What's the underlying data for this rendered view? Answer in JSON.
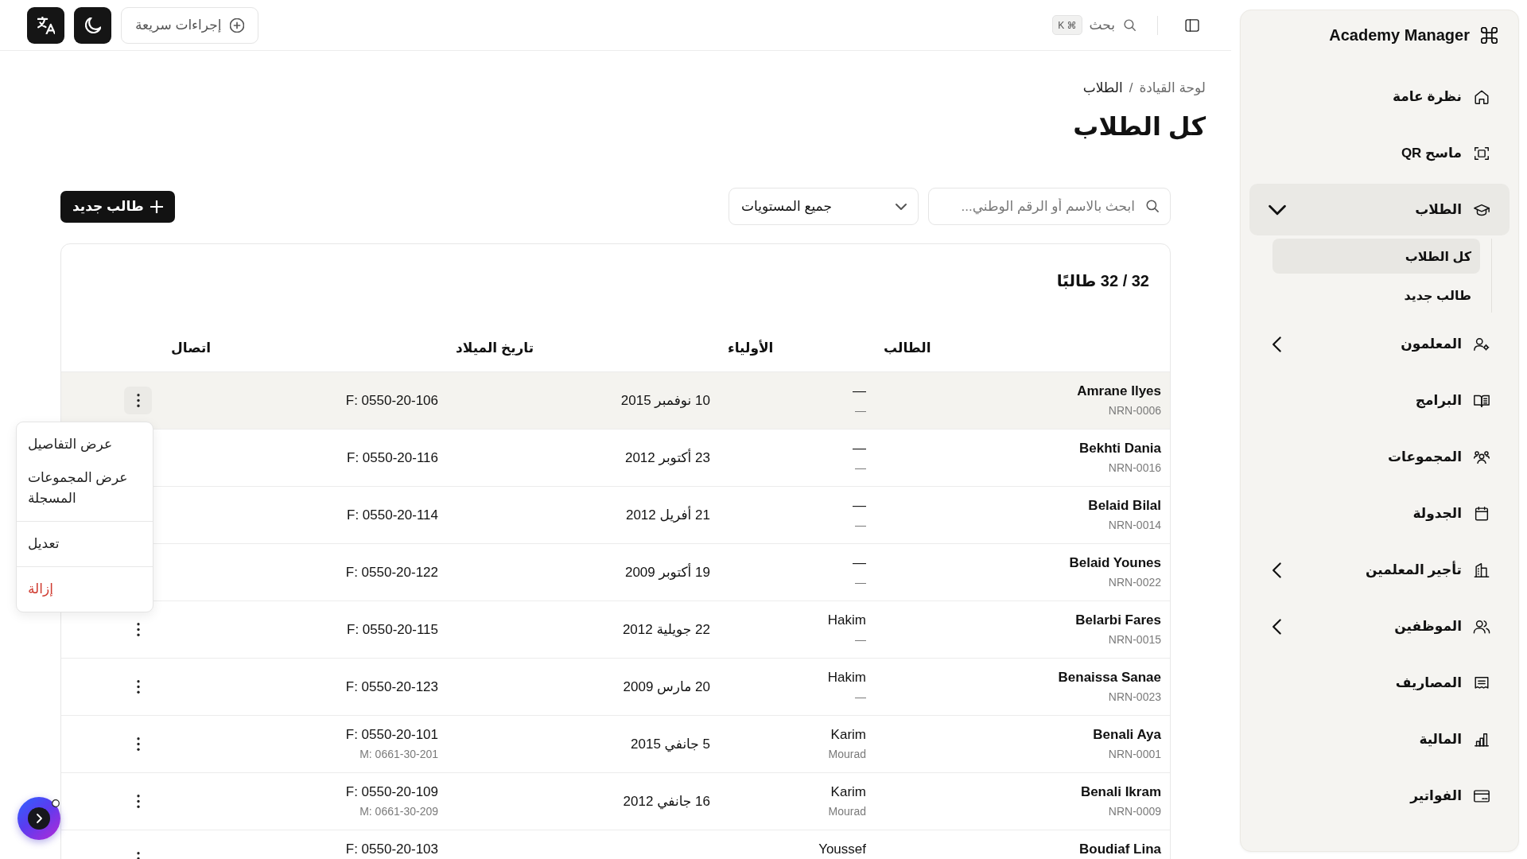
{
  "topbar": {
    "quick_actions": "إجراءات سريعة",
    "search": {
      "label": "بحث",
      "shortcut": "⌘ K"
    }
  },
  "sidebar": {
    "title": "Academy Manager",
    "items": [
      {
        "label": "نظرة عامة",
        "kind": "link",
        "selected": false
      },
      {
        "label": "ماسح QR",
        "kind": "link",
        "selected": false
      },
      {
        "label": "الطلاب",
        "kind": "group",
        "selected": true,
        "expanded": true,
        "children": [
          {
            "label": "كل الطلاب",
            "selected": true
          },
          {
            "label": "طالب جديد",
            "selected": false
          }
        ]
      },
      {
        "label": "المعلمون",
        "kind": "group",
        "selected": false,
        "expanded": false
      },
      {
        "label": "البرامج",
        "kind": "link",
        "selected": false
      },
      {
        "label": "المجموعات",
        "kind": "link",
        "selected": false
      },
      {
        "label": "الجدولة",
        "kind": "link",
        "selected": false
      },
      {
        "label": "تأجير المعلمين",
        "kind": "group",
        "selected": false,
        "expanded": false
      },
      {
        "label": "الموظفين",
        "kind": "group",
        "selected": false,
        "expanded": false
      },
      {
        "label": "المصاريف",
        "kind": "link",
        "selected": false
      },
      {
        "label": "المالية",
        "kind": "link",
        "selected": false
      },
      {
        "label": "الفواتير",
        "kind": "link",
        "selected": false
      }
    ]
  },
  "breadcrumb": {
    "items": [
      "لوحة القيادة",
      "الطلاب"
    ],
    "separator": "/"
  },
  "page_title": "كل الطلاب",
  "filters": {
    "search": {
      "placeholder": "ابحث بالاسم أو الرقم الوطني..."
    },
    "level": {
      "value": "جميع المستويات"
    },
    "new_button": "طالب جديد"
  },
  "table": {
    "count": "32 / 32 طالبًا",
    "columns": [
      "الطالب",
      "الأولياء",
      "تاريخ الميلاد",
      "اتصال"
    ],
    "rows": [
      {
        "name": "Amrane Ilyes",
        "nrn": "NRN-0006",
        "guardians": [
          "—",
          "—"
        ],
        "birth_date": "10 نوفمبر 2015",
        "contacts": [
          "F: 0550-20-106"
        ],
        "active": true
      },
      {
        "name": "Bekhti Dania",
        "nrn": "NRN-0016",
        "guardians": [
          "—",
          "—"
        ],
        "birth_date": "23 أكتوبر 2012",
        "contacts": [
          "F: 0550-20-116"
        ],
        "active": false
      },
      {
        "name": "Belaid Bilal",
        "nrn": "NRN-0014",
        "guardians": [
          "—",
          "—"
        ],
        "birth_date": "21 أفريل 2012",
        "contacts": [
          "F: 0550-20-114"
        ],
        "active": false
      },
      {
        "name": "Belaid Younes",
        "nrn": "NRN-0022",
        "guardians": [
          "—",
          "—"
        ],
        "birth_date": "19 أكتوبر 2009",
        "contacts": [
          "F: 0550-20-122"
        ],
        "active": false
      },
      {
        "name": "Belarbi Fares",
        "nrn": "NRN-0015",
        "guardians": [
          "Hakim",
          "—"
        ],
        "birth_date": "22 جويلية 2012",
        "contacts": [
          "F: 0550-20-115"
        ],
        "active": false
      },
      {
        "name": "Benaissa Sanae",
        "nrn": "NRN-0023",
        "guardians": [
          "Hakim",
          "—"
        ],
        "birth_date": "20 مارس 2009",
        "contacts": [
          "F: 0550-20-123"
        ],
        "active": false
      },
      {
        "name": "Benali Aya",
        "nrn": "NRN-0001",
        "guardians": [
          "Karim",
          "Mourad"
        ],
        "birth_date": "5 جانفي 2015",
        "contacts": [
          "F: 0550-20-101",
          "M: 0661-30-201"
        ],
        "active": false
      },
      {
        "name": "Benali Ikram",
        "nrn": "NRN-0009",
        "guardians": [
          "Karim",
          "Mourad"
        ],
        "birth_date": "16 جانفي 2012",
        "contacts": [
          "F: 0550-20-109",
          "M: 0661-30-209"
        ],
        "active": false
      },
      {
        "name": "Boudiaf Lina",
        "guardians": [
          "Youssef"
        ],
        "contacts": [
          "F: 0550-20-103"
        ],
        "active": false
      }
    ]
  },
  "row_menu": {
    "groups": [
      {
        "items": [
          {
            "label": "عرض التفاصيل",
            "kind": "normal"
          },
          {
            "label": "عرض المجموعات المسجلة",
            "kind": "normal"
          }
        ]
      },
      {
        "items": [
          {
            "label": "تعديل",
            "kind": "normal"
          }
        ]
      },
      {
        "items": [
          {
            "label": "إزالة",
            "kind": "danger"
          }
        ]
      }
    ]
  }
}
